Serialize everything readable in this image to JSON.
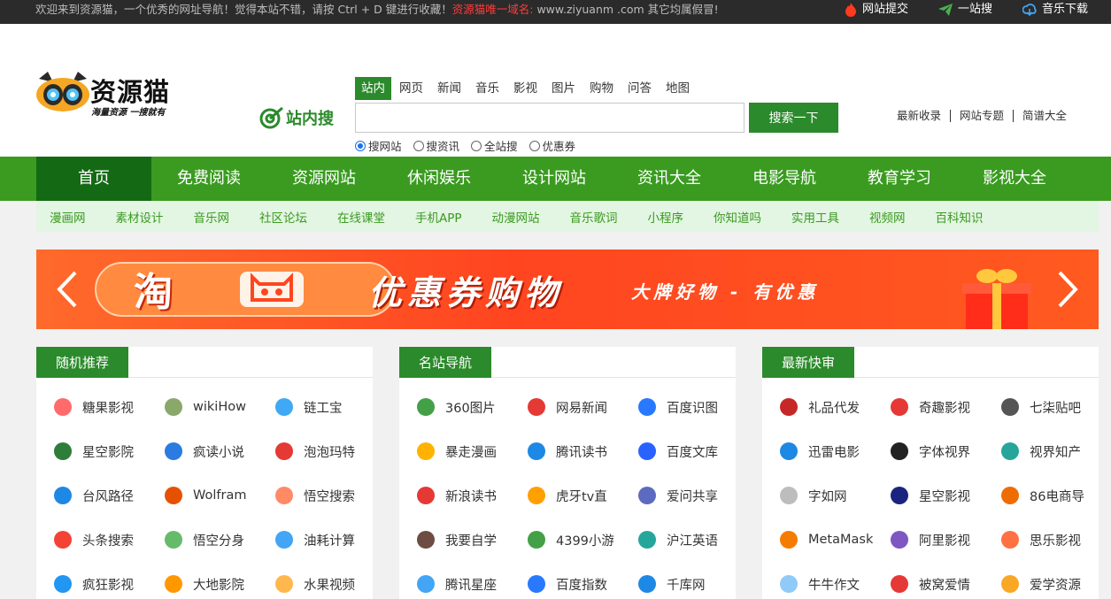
{
  "topbar": {
    "notice_prefix": "欢迎来到资源猫，一个优秀的网址导航！觉得本站不错，请按 Ctrl + D 键进行收藏！",
    "notice_highlight": "资源猫唯一域名:",
    "notice_suffix": " www.ziyuanm .com 其它均属假冒!",
    "links": [
      "网站提交",
      "一站搜",
      "音乐下载"
    ]
  },
  "logo": {
    "name": "资源猫",
    "slogan": "海量资源 一搜就有"
  },
  "search": {
    "site_label": "站内搜",
    "tabs": [
      "站内",
      "网页",
      "新闻",
      "音乐",
      "影视",
      "图片",
      "购物",
      "问答",
      "地图"
    ],
    "active_tab": "站内",
    "placeholder": "",
    "button": "搜索一下",
    "radios": [
      "搜网站",
      "搜资讯",
      "全站搜",
      "优惠券"
    ],
    "quick_links": [
      "最新收录",
      "网站专题",
      "简谱大全"
    ]
  },
  "nav": [
    "首页",
    "免费阅读",
    "资源网站",
    "休闲娱乐",
    "设计网站",
    "资讯大全",
    "电影导航",
    "教育学习",
    "影视大全"
  ],
  "subnav": [
    "漫画网",
    "素材设计",
    "音乐网",
    "社区论坛",
    "在线课堂",
    "手机APP",
    "动漫网站",
    "音乐歌词",
    "小程序",
    "你知道吗",
    "实用工具",
    "视频网",
    "百科知识"
  ],
  "banner": {
    "tao": "淘",
    "title": "优惠券购物",
    "subtitle": "大牌好物 - 有优惠"
  },
  "panels": [
    {
      "title": "随机推荐",
      "items": [
        {
          "label": "糖果影视",
          "color": "#ff6b6b"
        },
        {
          "label": "wikiHow",
          "color": "#8aa86a"
        },
        {
          "label": "链工宝",
          "color": "#3fa9f5"
        },
        {
          "label": "星空影院",
          "color": "#2f7d3a"
        },
        {
          "label": "疯读小说",
          "color": "#2b7be0"
        },
        {
          "label": "泡泡玛特",
          "color": "#e53935"
        },
        {
          "label": "台风路径",
          "color": "#1e88e5"
        },
        {
          "label": "Wolfram",
          "color": "#e65100"
        },
        {
          "label": "悟空搜索",
          "color": "#ff8a65"
        },
        {
          "label": "头条搜索",
          "color": "#f44336"
        },
        {
          "label": "悟空分身",
          "color": "#66bb6a"
        },
        {
          "label": "油耗计算",
          "color": "#42a5f5"
        },
        {
          "label": "疯狂影视",
          "color": "#2196f3"
        },
        {
          "label": "大地影院",
          "color": "#ff9800"
        },
        {
          "label": "水果视频",
          "color": "#ffb74d"
        }
      ]
    },
    {
      "title": "名站导航",
      "items": [
        {
          "label": "360图片",
          "color": "#43a047"
        },
        {
          "label": "网易新闻",
          "color": "#e53935"
        },
        {
          "label": "百度识图",
          "color": "#2979ff"
        },
        {
          "label": "暴走漫画",
          "color": "#ffb300"
        },
        {
          "label": "腾讯读书",
          "color": "#1e88e5"
        },
        {
          "label": "百度文库",
          "color": "#2962ff"
        },
        {
          "label": "新浪读书",
          "color": "#e53935"
        },
        {
          "label": "虎牙tv直",
          "color": "#ffa000"
        },
        {
          "label": "爱问共享",
          "color": "#5c6bc0"
        },
        {
          "label": "我要自学",
          "color": "#6d4c41"
        },
        {
          "label": "4399小游",
          "color": "#43a047"
        },
        {
          "label": "沪江英语",
          "color": "#26a69a"
        },
        {
          "label": "腾讯星座",
          "color": "#42a5f5"
        },
        {
          "label": "百度指数",
          "color": "#2979ff"
        },
        {
          "label": "千库网",
          "color": "#1e88e5"
        }
      ]
    },
    {
      "title": "最新快审",
      "items": [
        {
          "label": "礼品代发",
          "color": "#c62828"
        },
        {
          "label": "奇趣影视",
          "color": "#e53935"
        },
        {
          "label": "七柒贴吧",
          "color": "#555555"
        },
        {
          "label": "迅雷电影",
          "color": "#1e88e5"
        },
        {
          "label": "字体视界",
          "color": "#222222"
        },
        {
          "label": "视界知产",
          "color": "#26a69a"
        },
        {
          "label": "字如网",
          "color": "#bdbdbd"
        },
        {
          "label": "星空影视",
          "color": "#1a237e"
        },
        {
          "label": "86电商导",
          "color": "#ef6c00"
        },
        {
          "label": "MetaMask",
          "color": "#f57c00"
        },
        {
          "label": "阿里影视",
          "color": "#7e57c2"
        },
        {
          "label": "思乐影视",
          "color": "#ff7043"
        },
        {
          "label": "牛牛作文",
          "color": "#90caf9"
        },
        {
          "label": "被窝爱情",
          "color": "#e53935"
        },
        {
          "label": "爱学资源",
          "color": "#f9a825"
        }
      ]
    }
  ]
}
